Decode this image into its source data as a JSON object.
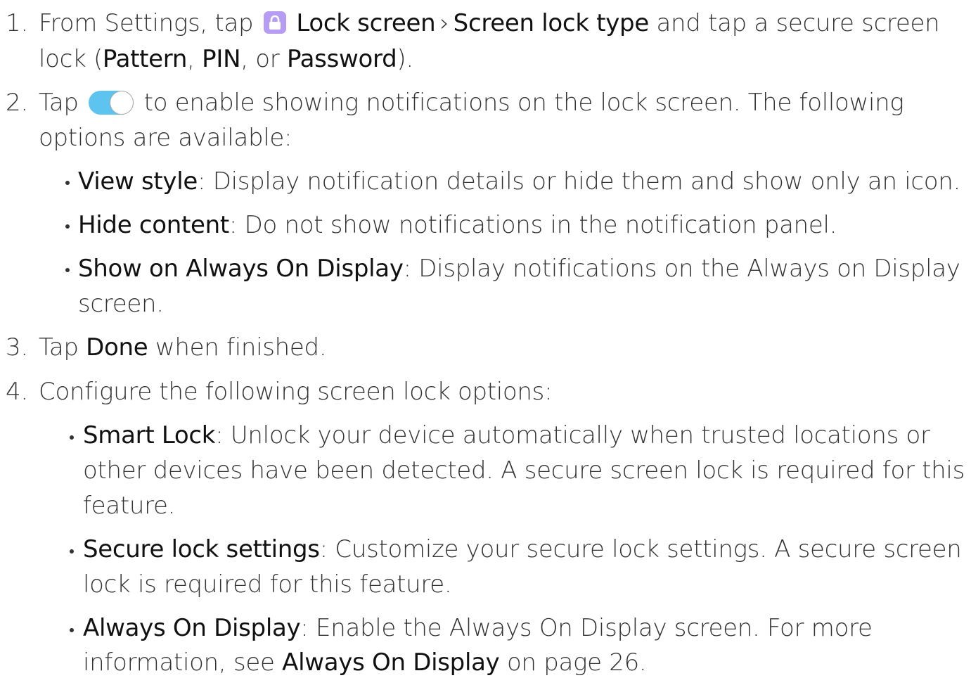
{
  "steps": [
    {
      "number": "1.",
      "l1_a": "From Settings, tap ",
      "l1_b": "Lock screen",
      "l1_sep": "›",
      "l1_c": "Screen lock type",
      "l1_d": " and tap a secure screen",
      "l2_a": "lock (",
      "l2_b": "Pattern",
      "l2_c": ", ",
      "l2_d": "PIN",
      "l2_e": ", or ",
      "l2_f": "Password",
      "l2_g": ")."
    },
    {
      "number": "2.",
      "l1_a": "Tap ",
      "l1_b": " to enable showing notifications on the lock screen. The following",
      "l2": "options are available:",
      "bullets": [
        {
          "term": "View style",
          "text": ": Display notification details or hide them and show only an icon."
        },
        {
          "term": "Hide content",
          "text": ": Do not show notifications in the notification panel."
        },
        {
          "term": "Show on Always On Display",
          "text": ": Display notifications on the Always on Display",
          "text2": "screen."
        }
      ]
    },
    {
      "number": "3.",
      "l1_a": "Tap ",
      "l1_b": "Done",
      "l1_c": " when finished."
    },
    {
      "number": "4.",
      "l1": "Configure the following screen lock options:",
      "bullets": [
        {
          "term": "Smart Lock",
          "text": ": Unlock your device automatically when trusted locations or",
          "text2": "other devices have been detected. A secure screen lock is required for this",
          "text3": "feature."
        },
        {
          "term": "Secure lock settings",
          "text": ": Customize your secure lock settings. A secure screen",
          "text2": "lock is required for this feature."
        },
        {
          "term": "Always On Display",
          "text": ": Enable the Always On Display screen. For more",
          "text2_a": "information, see ",
          "text2_b": "Always On Display",
          "text2_c": " on page 26."
        }
      ]
    }
  ],
  "icons": {
    "lock_icon": "lock-icon",
    "toggle_icon": "toggle-switch-icon"
  },
  "colors": {
    "lock_icon_bg": "#b69cf2",
    "toggle_track": "#5cc4ef"
  }
}
